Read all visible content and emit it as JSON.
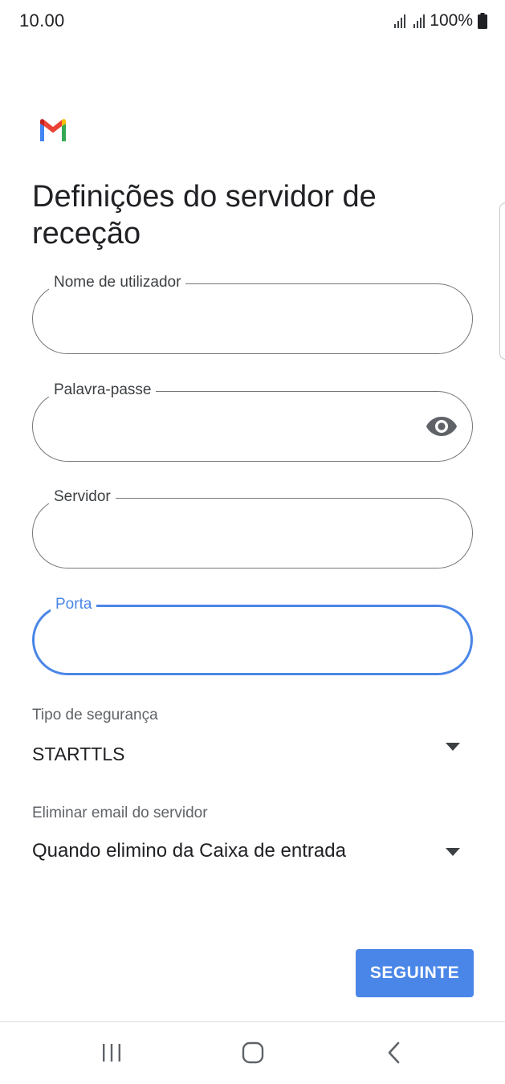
{
  "status_bar": {
    "time": "10.00",
    "battery": "100%"
  },
  "app": {
    "logo_icon": "gmail-logo",
    "title": "Definições do servidor de receção"
  },
  "form": {
    "username": {
      "label": "Nome de utilizador",
      "value": ""
    },
    "password": {
      "label": "Palavra-passe",
      "value": "",
      "toggle_icon": "eye-icon"
    },
    "server": {
      "label": "Servidor",
      "value": ""
    },
    "port": {
      "label": "Porta",
      "value": ""
    }
  },
  "security": {
    "label": "Tipo de segurança",
    "selected": "STARTTLS"
  },
  "delete_email": {
    "label": "Eliminar email do servidor",
    "selected": "Quando elimino da Caixa de entrada"
  },
  "actions": {
    "next_label": "SEGUINTE"
  },
  "colors": {
    "accent": "#4a86e8",
    "outline": "#747775",
    "text": "#202124"
  }
}
